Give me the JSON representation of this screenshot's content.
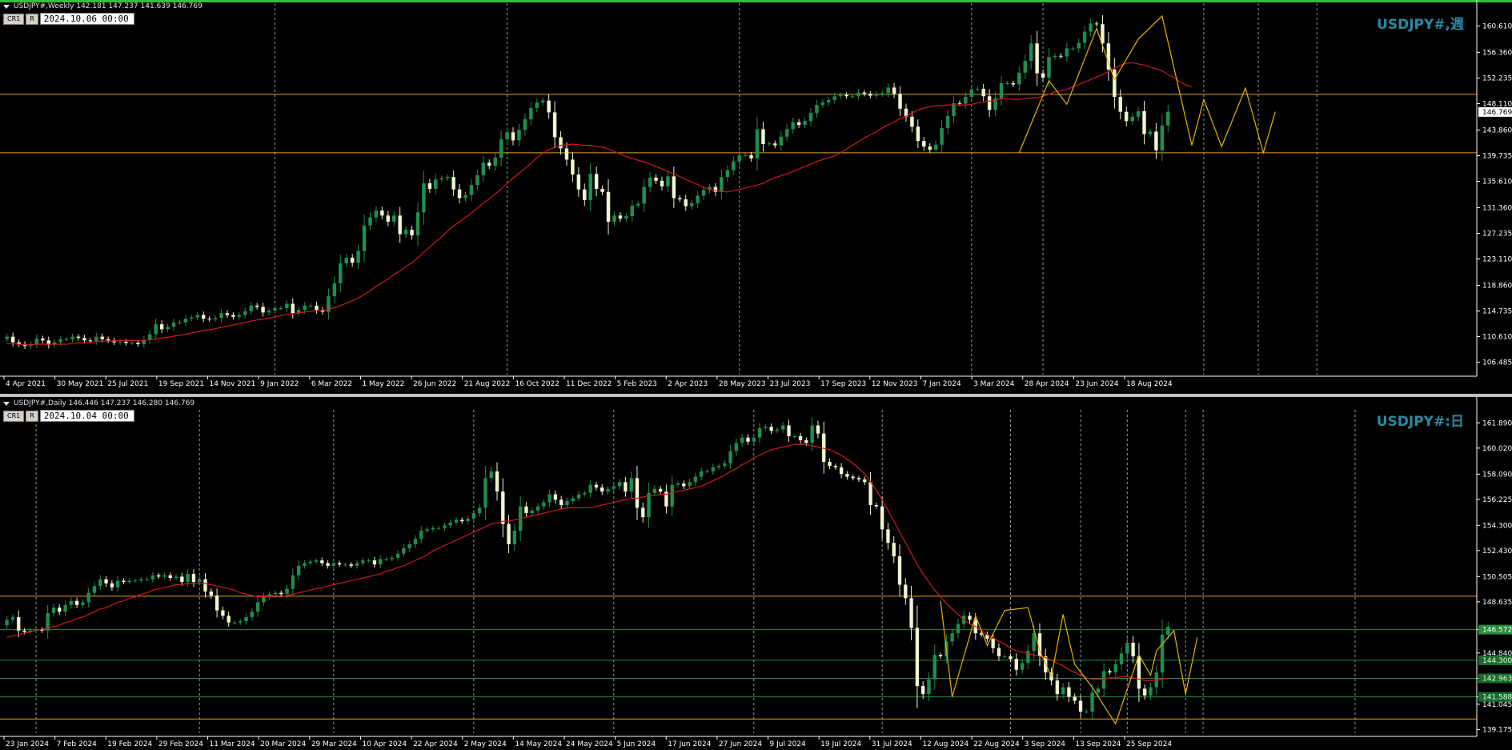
{
  "colors": {
    "bg": "#000000",
    "bull": "#1f8f4e",
    "bear": "#f0f5d0",
    "ma": "#d21a1a",
    "zigzag": "#e8b400",
    "hline": "#e6a12a",
    "greenline": "#2b8a3e",
    "grid": "#9a9a9a",
    "axis": "#ffffff",
    "top_border": "#36c03a",
    "symbol": "#2a8aa4"
  },
  "weekly": {
    "header": "USDJPY#,Weekly  142.181 147.237 141.639 146.769",
    "tag_cr": "CR1",
    "tag_r": "R",
    "datetime": "2024.10.06 00:00",
    "symbol_label": "USDJPY#,週",
    "price_min": 104.5,
    "price_max": 163.5,
    "price_ticks": [
      "160.610",
      "156.360",
      "152.235",
      "148.110",
      "143.860",
      "139.735",
      "135.610",
      "131.360",
      "127.235",
      "123.110",
      "118.860",
      "114.735",
      "110.610",
      "106.485"
    ],
    "price_tag": "146.769",
    "price_tag_value": 146.769,
    "hlines": [
      149.6,
      140.2
    ],
    "date_labels": [
      "4 Apr 2021",
      "30 May 2021",
      "25 Jul 2021",
      "19 Sep 2021",
      "14 Nov 2021",
      "9 Jan 2022",
      "6 Mar 2022",
      "1 May 2022",
      "26 Jun 2022",
      "21 Aug 2022",
      "16 Oct 2022",
      "11 Dec 2022",
      "5 Feb 2023",
      "2 Apr 2023",
      "28 May 2023",
      "23 Jul 2023",
      "17 Sep 2023",
      "12 Nov 2023",
      "7 Jan 2024",
      "3 Mar 2024",
      "28 Apr 2024",
      "23 Jun 2024",
      "18 Aug 2024"
    ],
    "closes": [
      110.6,
      109.7,
      109.4,
      109.1,
      109.4,
      110.3,
      110.0,
      109.3,
      109.7,
      110.2,
      110.2,
      110.6,
      110.4,
      110.0,
      109.9,
      110.6,
      110.2,
      110.0,
      109.7,
      109.8,
      109.6,
      109.6,
      109.4,
      110.1,
      111.0,
      112.6,
      111.8,
      112.2,
      112.9,
      112.9,
      113.5,
      113.7,
      114.1,
      113.5,
      113.4,
      113.6,
      114.4,
      114.1,
      113.8,
      114.1,
      114.7,
      115.6,
      115.4,
      114.5,
      114.8,
      115.2,
      115.2,
      115.9,
      114.4,
      114.9,
      115.6,
      115.6,
      114.9,
      114.6,
      117.1,
      119.2,
      122.4,
      123.3,
      122.5,
      124.4,
      128.5,
      129.8,
      130.9,
      130.1,
      129.1,
      130.1,
      127.1,
      127.8,
      126.9,
      130.6,
      135.3,
      134.4,
      135.9,
      136.1,
      136.3,
      134.3,
      132.9,
      133.4,
      135.0,
      136.6,
      138.6,
      138.1,
      139.4,
      142.4,
      143.5,
      142.2,
      143.9,
      145.6,
      147.4,
      148.3,
      148.6,
      146.7,
      142.7,
      140.9,
      139.1,
      136.7,
      134.3,
      132.6,
      136.8,
      134.4,
      133.9,
      129.1,
      130.1,
      129.6,
      130.0,
      131.7,
      132.0,
      134.7,
      136.2,
      135.7,
      134.8,
      136.4,
      132.9,
      132.7,
      131.6,
      132.1,
      133.3,
      134.2,
      134.7,
      133.9,
      136.3,
      137.4,
      138.8,
      139.8,
      139.8,
      139.3,
      144.0,
      141.6,
      141.7,
      141.4,
      142.8,
      144.0,
      145.1,
      144.7,
      145.3,
      146.6,
      147.9,
      148.3,
      148.7,
      149.3,
      149.5,
      149.3,
      149.3,
      149.9,
      149.7,
      149.4,
      149.6,
      149.8,
      150.7,
      149.7,
      147.3,
      146.0,
      144.4,
      142.1,
      141.2,
      140.7,
      141.5,
      144.2,
      146.1,
      148.2,
      148.1,
      149.2,
      150.4,
      150.5,
      149.3,
      147.1,
      149.0,
      151.4,
      151.4,
      151.2,
      153.1,
      155.0,
      157.8,
      153.0,
      152.3,
      155.6,
      155.8,
      155.7,
      157.0,
      157.0,
      157.9,
      159.7,
      161.0,
      160.9,
      157.8,
      153.6,
      149.2,
      146.8,
      145.3,
      146.0,
      146.9,
      143.2,
      143.6,
      140.6,
      144.6,
      146.8
    ],
    "ma": [
      109.5,
      109.5,
      109.4,
      109.3,
      109.3,
      109.4,
      109.4,
      109.4,
      109.4,
      109.4,
      109.4,
      109.5,
      109.6,
      109.6,
      109.7,
      109.8,
      109.9,
      109.9,
      109.9,
      110.0,
      110.0,
      110.0,
      110.0,
      110.0,
      110.1,
      110.2,
      110.4,
      110.5,
      110.7,
      110.8,
      111.0,
      111.2,
      111.4,
      111.6,
      111.7,
      111.9,
      112.1,
      112.3,
      112.5,
      112.7,
      112.9,
      113.1,
      113.3,
      113.4,
      113.6,
      113.8,
      114.0,
      114.2,
      114.3,
      114.4,
      114.6,
      114.7,
      114.8,
      114.8,
      115.0,
      115.3,
      115.6,
      116.0,
      116.4,
      116.8,
      117.4,
      118.0,
      118.7,
      119.3,
      119.9,
      120.6,
      121.2,
      121.9,
      122.5,
      123.3,
      124.2,
      125.0,
      125.9,
      126.7,
      127.6,
      128.4,
      129.1,
      129.8,
      130.5,
      131.3,
      132.1,
      132.8,
      133.6,
      134.4,
      135.3,
      136.1,
      136.9,
      137.7,
      138.5,
      139.4,
      140.1,
      140.7,
      141.1,
      141.4,
      141.5,
      141.6,
      141.5,
      141.4,
      141.4,
      141.2,
      141.1,
      140.8,
      140.4,
      140.0,
      139.6,
      139.3,
      139.0,
      138.7,
      138.4,
      138.0,
      137.6,
      137.2,
      136.8,
      136.4,
      135.9,
      135.5,
      135.1,
      134.6,
      134.3,
      134.1,
      134.0,
      133.9,
      134.1,
      134.3,
      134.5,
      134.8,
      135.0,
      135.3,
      135.8,
      136.2,
      136.5,
      136.8,
      137.2,
      137.6,
      138.0,
      138.4,
      138.8,
      139.1,
      139.4,
      139.7,
      140.2,
      140.8,
      141.4,
      142.0,
      142.6,
      143.1,
      143.6,
      144.2,
      144.7,
      145.2,
      145.7,
      146.1,
      146.6,
      147.1,
      147.4,
      147.6,
      147.8,
      147.8,
      147.9,
      147.9,
      147.9,
      147.9,
      148.0,
      148.2,
      148.4,
      148.5,
      148.7,
      148.9,
      148.9,
      148.8,
      148.8,
      148.9,
      149.0,
      149.1,
      149.3,
      149.6,
      150.0,
      150.2,
      150.4,
      150.8,
      151.2,
      151.6,
      152.0,
      152.4,
      152.8,
      153.3,
      153.8,
      154.3,
      154.6,
      154.7,
      154.5,
      154.3,
      154.0,
      153.7,
      153.4,
      152.8,
      152.3,
      151.6,
      151.1,
      150.8
    ],
    "zigzag": [
      [
        170,
        140.2
      ],
      [
        175,
        151.8
      ],
      [
        178,
        148.0
      ],
      [
        183,
        160.2
      ],
      [
        186,
        152.0
      ],
      [
        190,
        158.5
      ],
      [
        194,
        162.2
      ],
      [
        199,
        141.4
      ],
      [
        201,
        148.8
      ],
      [
        204,
        141.2
      ],
      [
        208,
        150.6
      ],
      [
        211,
        140.2
      ],
      [
        213,
        146.8
      ]
    ],
    "vlines": [
      45,
      84,
      123,
      162,
      174,
      201,
      220
    ]
  },
  "daily": {
    "header": "USDJPY#,Daily  146.446 147.237 146.280 146.769",
    "tag_cr": "CR1",
    "tag_r": "R",
    "datetime": "2024.10.04 00:00",
    "symbol_label": "USDJPY#:日",
    "price_min": 138.9,
    "price_max": 162.5,
    "price_ticks": [
      "161.890",
      "160.020",
      "158.090",
      "156.225",
      "154.300",
      "152.430",
      "150.505",
      "148.635",
      "146.572",
      "144.840",
      "142.963",
      "141.588",
      "141.045",
      "139.175"
    ],
    "price_tag": "146.572",
    "price_tag_value": 146.572,
    "tag_labels": [
      "144.300",
      "142.963",
      "141.588"
    ],
    "tag_values": [
      144.3,
      142.963,
      141.588
    ],
    "hlines": [
      149.05,
      139.95
    ],
    "green_lines": [
      146.572,
      144.3,
      142.963,
      141.588
    ],
    "date_labels": [
      "23 Jan 2024",
      "7 Feb 2024",
      "19 Feb 2024",
      "29 Feb 2024",
      "11 Mar 2024",
      "20 Mar 2024",
      "29 Mar 2024",
      "10 Apr 2024",
      "22 Apr 2024",
      "2 May 2024",
      "14 May 2024",
      "24 May 2024",
      "5 Jun 2024",
      "17 Jun 2024",
      "27 Jun 2024",
      "9 Jul 2024",
      "19 Jul 2024",
      "31 Jul 2024",
      "12 Aug 2024",
      "22 Aug 2024",
      "3 Sep 2024",
      "13 Sep 2024",
      "25 Sep 2024"
    ],
    "closes": [
      147.3,
      147.5,
      146.5,
      146.4,
      146.5,
      146.6,
      146.5,
      147.8,
      148.2,
      147.9,
      148.4,
      148.7,
      148.4,
      148.6,
      149.3,
      149.8,
      150.3,
      150.0,
      149.7,
      150.2,
      150.1,
      150.2,
      150.2,
      150.3,
      150.3,
      150.6,
      150.5,
      150.6,
      150.4,
      150.5,
      150.1,
      150.7,
      150.1,
      150.3,
      149.4,
      149.1,
      148.0,
      147.6,
      147.1,
      147.1,
      147.2,
      147.5,
      147.9,
      148.6,
      149.0,
      149.2,
      149.3,
      149.2,
      149.6,
      150.6,
      151.3,
      151.5,
      151.6,
      151.7,
      151.5,
      151.3,
      151.5,
      151.4,
      151.4,
      151.3,
      151.5,
      151.7,
      151.7,
      151.4,
      151.8,
      151.8,
      151.9,
      152.2,
      152.6,
      152.9,
      153.3,
      153.9,
      154.0,
      154.1,
      154.1,
      154.3,
      154.5,
      154.7,
      154.6,
      154.8,
      155.2,
      155.6,
      157.8,
      158.3,
      156.8,
      154.4,
      152.9,
      153.9,
      155.7,
      155.2,
      155.4,
      155.7,
      156.0,
      156.6,
      156.2,
      155.8,
      156.1,
      156.3,
      156.6,
      156.7,
      157.3,
      157.1,
      156.8,
      157.0,
      157.2,
      157.5,
      156.8,
      157.8,
      155.6,
      154.9,
      156.7,
      157.0,
      156.8,
      155.7,
      157.3,
      157.4,
      157.2,
      157.5,
      157.9,
      158.3,
      158.3,
      158.6,
      158.7,
      158.9,
      159.8,
      160.4,
      160.8,
      160.5,
      160.8,
      161.5,
      161.6,
      161.3,
      161.4,
      161.7,
      160.9,
      160.9,
      160.6,
      160.4,
      161.7,
      161.1,
      159.0,
      158.7,
      158.6,
      158.1,
      157.9,
      157.8,
      157.7,
      157.5,
      155.8,
      155.7,
      154.0,
      153.0,
      152.0,
      149.9,
      148.9,
      146.7,
      142.4,
      141.8,
      142.9,
      144.7,
      144.6,
      145.7,
      146.3,
      147.0,
      147.6,
      147.3,
      146.3,
      146.2,
      145.9,
      145.2,
      144.6,
      144.6,
      144.4,
      143.6,
      144.1,
      145.0,
      146.3,
      144.6,
      143.4,
      142.8,
      141.8,
      142.3,
      141.6,
      141.3,
      140.5,
      140.5,
      141.9,
      142.2,
      143.5,
      143.4,
      144.0,
      144.8,
      145.6,
      144.6,
      142.2,
      141.7,
      142.3,
      143.4,
      146.2,
      146.8
    ],
    "ma": [
      146.0,
      146.1,
      146.2,
      146.3,
      146.4,
      146.5,
      146.6,
      146.7,
      146.8,
      146.9,
      147.1,
      147.2,
      147.4,
      147.5,
      147.7,
      147.9,
      148.1,
      148.2,
      148.4,
      148.6,
      148.7,
      148.9,
      149.0,
      149.2,
      149.3,
      149.5,
      149.6,
      149.7,
      149.8,
      149.9,
      149.9,
      150.0,
      150.0,
      150.0,
      150.0,
      149.9,
      149.8,
      149.7,
      149.6,
      149.5,
      149.3,
      149.2,
      149.1,
      149.0,
      149.0,
      149.0,
      149.0,
      149.0,
      149.1,
      149.2,
      149.3,
      149.4,
      149.5,
      149.6,
      149.7,
      149.8,
      149.9,
      150.0,
      150.1,
      150.2,
      150.3,
      150.4,
      150.5,
      150.6,
      150.7,
      150.9,
      151.0,
      151.2,
      151.3,
      151.5,
      151.7,
      151.9,
      152.1,
      152.4,
      152.6,
      152.8,
      153.0,
      153.2,
      153.4,
      153.6,
      153.8,
      154.0,
      154.2,
      154.4,
      154.5,
      154.6,
      154.6,
      154.7,
      154.8,
      154.9,
      155.0,
      155.1,
      155.2,
      155.3,
      155.4,
      155.5,
      155.6,
      155.6,
      155.6,
      155.6,
      155.6,
      155.7,
      155.8,
      155.9,
      156.0,
      156.1,
      156.2,
      156.3,
      156.3,
      156.4,
      156.5,
      156.5,
      156.6,
      156.6,
      156.7,
      156.8,
      156.9,
      157.0,
      157.1,
      157.2,
      157.4,
      157.6,
      157.8,
      158.0,
      158.3,
      158.5,
      158.8,
      159.0,
      159.3,
      159.5,
      159.7,
      159.9,
      160.0,
      160.1,
      160.2,
      160.3,
      160.3,
      160.3,
      160.2,
      160.1,
      160.0,
      159.9,
      159.7,
      159.5,
      159.2,
      158.9,
      158.5,
      158.1,
      157.5,
      156.9,
      156.2,
      155.4,
      154.6,
      153.8,
      153.0,
      152.2,
      151.4,
      150.7,
      150.1,
      149.5,
      149.0,
      148.5,
      148.1,
      147.7,
      147.3,
      147.0,
      146.8,
      146.5,
      146.2,
      146.0,
      145.7,
      145.5,
      145.2,
      145.0,
      144.9,
      144.8,
      144.7,
      144.6,
      144.5,
      144.3,
      144.1,
      143.9,
      143.6,
      143.4,
      143.2,
      143.0,
      142.9,
      142.9,
      142.9,
      143.0,
      143.0,
      143.1,
      143.1,
      143.0,
      142.9,
      142.8,
      142.8,
      142.8,
      142.9,
      143.0
    ],
    "zigzag": [
      [
        160,
        148.7
      ],
      [
        162,
        141.6
      ],
      [
        166,
        147.6
      ],
      [
        168,
        145.4
      ],
      [
        171,
        148.0
      ],
      [
        175,
        148.2
      ],
      [
        177,
        145.0
      ],
      [
        179,
        143.1
      ],
      [
        181,
        147.7
      ],
      [
        183,
        144.0
      ],
      [
        186,
        142.3
      ],
      [
        190,
        139.6
      ],
      [
        194,
        144.7
      ],
      [
        196,
        143.2
      ],
      [
        197,
        145.0
      ],
      [
        200,
        146.5
      ],
      [
        202,
        141.8
      ],
      [
        204,
        146.0
      ]
    ],
    "vlines": [
      5,
      33,
      56,
      80,
      104,
      128,
      150,
      172,
      184,
      192,
      202,
      205
    ]
  }
}
